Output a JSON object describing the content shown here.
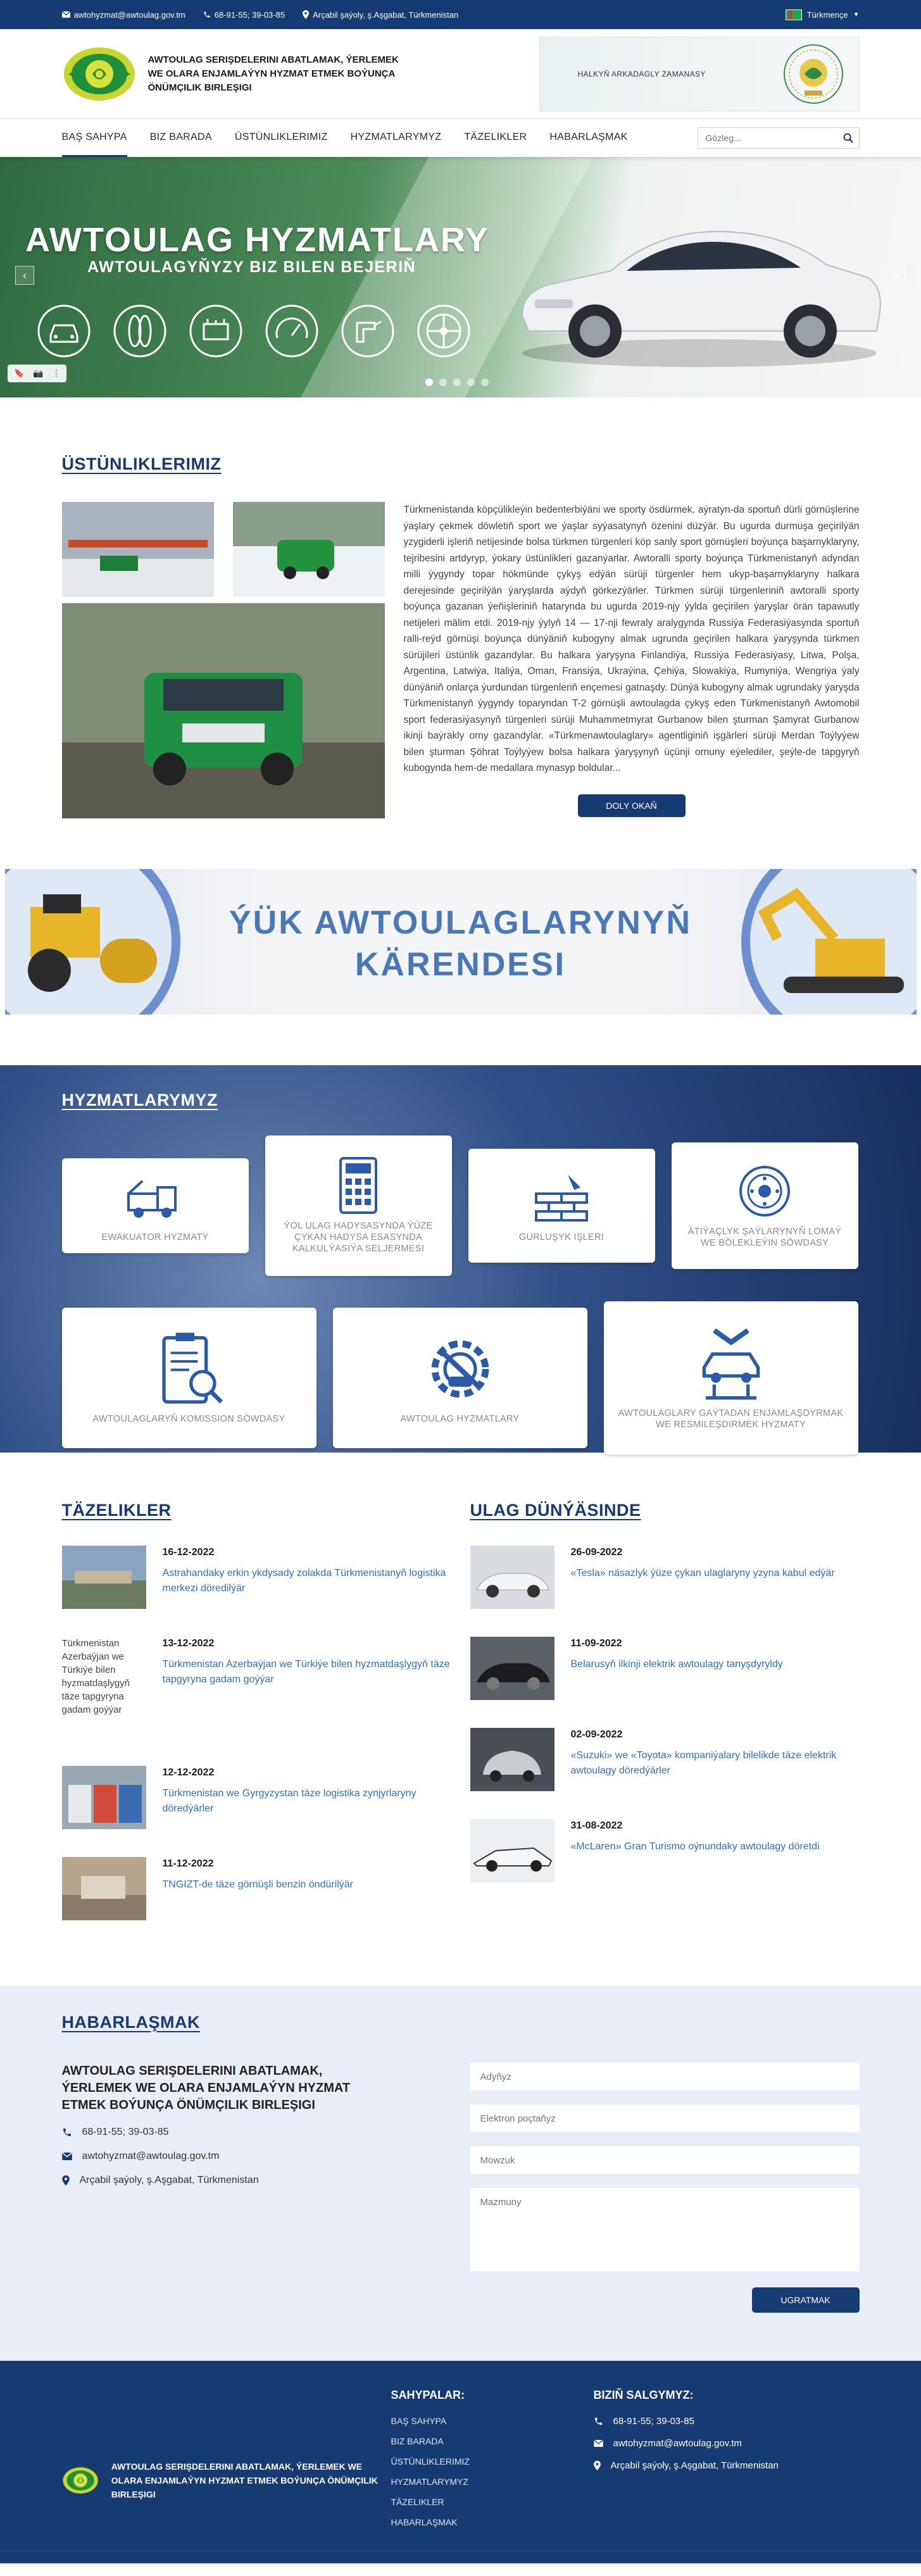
{
  "topbar": {
    "email": "awtohyzmat@awtoulag.gov.tm",
    "phone": "68-91-55; 39-03-85",
    "address": "Arçabil şaýoly, ş.Aşgabat, Türkmenistan",
    "language": "Türkmençe"
  },
  "header": {
    "org_title": "AWTOULAG SERIŞDELERINI ABATLAMAK, ÝERLEMEK WE OLARA ENJAMLAÝYN HYZMAT ETMEK BOÝUNÇA ÖNÜMÇILIK BIRLEŞIGI",
    "ad_text": "HALKYŇ ARKADAGLY ZAMANASY"
  },
  "nav": {
    "items": [
      "BAŞ SAHYPA",
      "BIZ BARADA",
      "ÜSTÜNLIKLERIMIZ",
      "HYZMATLARYMYZ",
      "TÄZELIKLER",
      "HABARLAŞMAK"
    ],
    "search_placeholder": "Gözleg..."
  },
  "hero": {
    "title": "AWTOULAG HYZMATLARY",
    "subtitle": "AWTOULAGYŇYZY BIZ BILEN BEJERIŇ",
    "slide_count": 5,
    "active_slide": 1
  },
  "advantages": {
    "title": "ÜSTÜNLIKLERIMIZ",
    "text": "Türkmenistanda köpçülikleýin bedenterbiýäni we sporty ösdürmek, aýratyn-da sportuň dürli görnüşlerine ýaşlary çekmek döwletiň sport we ýaşlar syýasatynyň özenini düzýär. Bu ugurda durmuşa geçirilýän yzygiderli işleriň netijesinde bolsa türkmen türgenleri köp sanly sport görnüşleri boýunça başarnyklaryny, tejribesini artdyryp, ýokary üstünlikleri gazanýarlar. Awtoralli sporty boýunça Türkmenistanyň adyndan milli ýygyndy topar hökmünde çykyş edýän sürüji türgenler hem ukyp-başarnyklaryny halkara derejesinde geçirilýän ýaryşlarda aýdyň görkezýärler. Türkmen sürüji türgenleriniň awtoralli sporty boýunça gazanan ýeňişleriniň hatarynda bu ugurda 2019-njy ýylda geçirilen ýaryşlar örän tapawutly netijeleri mälim etdi. 2019-njy ýylyň 14 — 17-nji fewraly aralygynda Russiýa Federasiýasynda sportuň ralli-reýd görnüşi boýunça dünýäniň kubogyny almak ugrunda geçirilen halkara ýaryşynda türkmen sürüjileri üstünlik gazandylar. Bu halkara ýaryşyna Finlandiýa, Russiýa Federasiýasy, Litwa, Polşa, Argentina, Latwiýa, Italiýa, Oman, Fransiýa, Ukraýina, Çehiýa, Slowakiýa, Rumyniýa, Wengriýa ýaly dünýäniň onlarça ýurdundan türgenleriň ençemesi gatnaşdy. Dünýä kubogyny almak ugrundaky ýaryşda Türkmenistanyň ýygyndy toparyndan T-2 görnüşli awtoulagda çykyş eden Türkmenistanyň Awtomobil sport federasiýasynyň türgenleri sürüji Muhammetmyrat Gurbanow bilen şturman Şamyrat Gurbanow ikinji baýrakly orny gazandylar. «Türkmenawtoulaglary» agentliginiň işgärleri sürüji Merdan Toýlyýew bilen şturman Şöhrat Toýlyýew bolsa halkara ýaryşynyň üçünji ornuny eýelediler, şeýle-de tapgyryň kubogynda hem-de medallara mynasyp boldular...",
    "more_label": "DOLY OKAŇ"
  },
  "banner": {
    "line1": "ÝÜK AWTOULAGLARYNYŇ",
    "line2": "KÄRENDESI"
  },
  "services": {
    "title": "HYZMATLARYMYZ",
    "items": [
      {
        "label": "EWAKUATOR HYZMATY",
        "icon": "tow-truck-icon"
      },
      {
        "label": "ÝOL ULAG HADYSASYNDA ÝÜZE ÇYKAN HADYSA ESASYNDA KALKULÝASIÝA SELJERMESI",
        "icon": "calculator-icon"
      },
      {
        "label": "GURLUŞYK IŞLERI",
        "icon": "bricks-trowel-icon"
      },
      {
        "label": "ÄTIÝAÇLYK ŞAÝLARYNYŇ LOMAÝ WE BÖLEKLEÝIN SÖWDASY",
        "icon": "brake-disc-icon"
      },
      {
        "label": "AWTOULAGLARYŇ KOMISSION SÖWDASY",
        "icon": "clipboard-car-icon"
      },
      {
        "label": "AWTOULAG HYZMATLARY",
        "icon": "gear-wrench-icon"
      },
      {
        "label": "AWTOULAGLARY GAÝTADAN ENJAMLAŞDYRMAK WE RESMILEŞDIRMEK HYZMATY",
        "icon": "car-lift-icon"
      }
    ]
  },
  "news": {
    "title": "TÄZELIKLER",
    "items": [
      {
        "date": "16-12-2022",
        "title": "Astrahandaky erkin ykdysady zolakda Türkmenistanyň logistika merkezi döredilýär"
      },
      {
        "date": "13-12-2022",
        "title": "Türkmenistan Azerbaýjan we Türkiýe bilen hyzmatdaşlygyň täze tapgyryna gadam goýýar",
        "alt": "Türkmenistan Azerbaýjan we Türkiýe bilen hyzmatdaşlygyň täze tapgyryna gadam goýýar"
      },
      {
        "date": "12-12-2022",
        "title": "Türkmenistan we Gyrgyzystan täze logistika zynjyrlaryny döredýärler"
      },
      {
        "date": "11-12-2022",
        "title": "TNGIZT-de täze görnüşli benzin öndürilýär"
      }
    ]
  },
  "world": {
    "title": "ULAG DÜNÝÄSINDE",
    "items": [
      {
        "date": "26-09-2022",
        "title": "«Tesla» näsazlyk ýüze çykan ulaglaryny yzyna kabul edýär"
      },
      {
        "date": "11-09-2022",
        "title": "Belarusyň ilkinji elektrik awtoulagy tanyşdyryldy"
      },
      {
        "date": "02-09-2022",
        "title": "«Suzuki» we «Toyota» kompaniýalary bilelikde täze elektrik awtoulagy döredýärler"
      },
      {
        "date": "31-08-2022",
        "title": "«McLaren» Gran Turismo oýnundaky awtoulagy döretdi"
      }
    ]
  },
  "contact": {
    "title": "HABARLAŞMAK",
    "org": "AWTOULAG SERIŞDELERINI ABATLAMAK, ÝERLEMEK WE OLARA ENJAMLAÝYN HYZMAT ETMEK BOÝUNÇA ÖNÜMÇILIK BIRLEŞIGI",
    "phone": "68-91-55; 39-03-85",
    "email": "awtohyzmat@awtoulag.gov.tm",
    "address": "Arçabil şaýoly, ş.Aşgabat, Türkmenistan",
    "form": {
      "name_placeholder": "Adyňyz",
      "email_placeholder": "Elektron poçtaňyz",
      "subject_placeholder": "Mowzuk",
      "message_placeholder": "Mazmuny",
      "submit_label": "UGRATMAK"
    }
  },
  "footer": {
    "org": "AWTOULAG SERIŞDELERINI ABATLAMAK, ÝERLEMEK WE OLARA ENJAMLAÝYN HYZMAT ETMEK BOÝUNÇA ÖNÜMÇILIK BIRLEŞIGI",
    "pages_title": "SAHYPALAR:",
    "pages": [
      "BAŞ SAHYPA",
      "BIZ BARADA",
      "ÜSTÜNLIKLERIMIZ",
      "HYZMATLARYMYZ",
      "TÄZELIKLER",
      "HABARLAŞMAK"
    ],
    "sales_title": "BIZIŇ SALGYMYZ:",
    "phone": "68-91-55; 39-03-85",
    "email": "awtohyzmat@awtoulag.gov.tm",
    "address": "Arçabil şaýoly, ş.Aşgabat, Türkmenistan"
  },
  "colors": {
    "brand": "#163a72",
    "link": "#2f6fc5",
    "hero_green": "#4c8a58",
    "banner_text": "#4a77b8"
  }
}
